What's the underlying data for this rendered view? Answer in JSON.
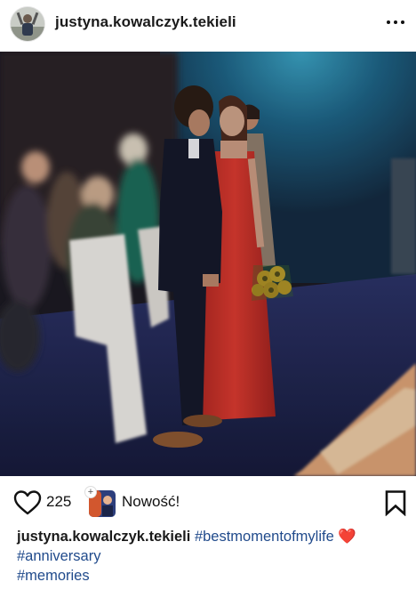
{
  "post": {
    "username": "justyna.kowalczyk.tekieli",
    "like_count": "225",
    "collab_label": "Nowość!",
    "caption": {
      "username": "justyna.kowalczyk.tekieli",
      "hashtags": [
        "#bestmomentofmylife",
        "#anniversary",
        "#memories"
      ],
      "emoji": "❤️"
    }
  },
  "icons": {
    "more": "more-horizontal-icon",
    "like": "heart-outline-icon",
    "save": "bookmark-outline-icon"
  },
  "colors": {
    "hashtag": "#214b8c",
    "text": "#111111",
    "dress": "#c8322a",
    "background_wall": "#1e6f8d"
  }
}
